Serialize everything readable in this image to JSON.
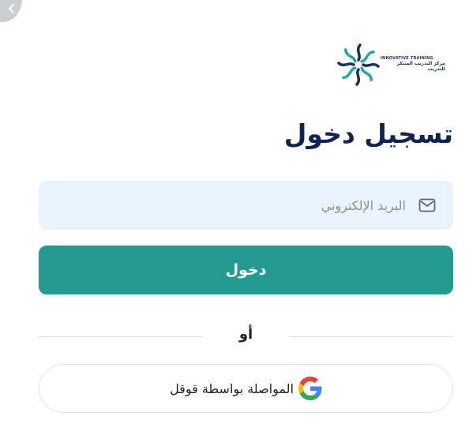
{
  "header": {
    "back_icon": "chevron-left-icon",
    "logo": {
      "en_text": "INNOVATIVE TRAINING",
      "ar_text": "مركز التدريب المبتكر للتدريب",
      "colors": [
        "#1d2e5a",
        "#2aa6a0"
      ]
    }
  },
  "login": {
    "title": "تسجيل دخول",
    "email": {
      "placeholder": "البريد الإلكتروني",
      "value": "",
      "icon": "mail-icon"
    },
    "submit_label": "دخول",
    "or_label": "أو",
    "google": {
      "label": "المواصلة بواسطة قوقل",
      "icon": "google-icon"
    }
  },
  "colors": {
    "primary": "#239b8f",
    "title": "#0f2454",
    "input_bg": "#e9f4fe",
    "border": "#dfe3e8"
  }
}
